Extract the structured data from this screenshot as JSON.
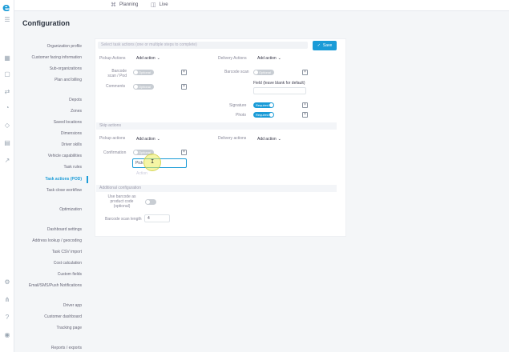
{
  "app": {
    "logo": "e",
    "title": "Configuration"
  },
  "topbar": {
    "planning_label": "Planning",
    "planning_icon": "planning-icon",
    "live_label": "Live",
    "live_icon": "live-icon"
  },
  "rail_icons": [
    "menu-icon",
    "grid-icon",
    "box-icon",
    "route-icon",
    "users-icon",
    "tag-icon",
    "report-icon",
    "chart-icon",
    "settings-icon",
    "network-icon",
    "help-icon",
    "account-icon"
  ],
  "sidebar": {
    "items": [
      "Organization profile",
      "Customer facing information",
      "Sub-organizations",
      "Plan and billing",
      "Depots",
      "Zones",
      "Saved locations",
      "Dimensions",
      "Driver skills",
      "Vehicle capabilities",
      "Task rules",
      "Task actions (POD)",
      "Task close workflow",
      "Optimization",
      "Dashboard settings",
      "Address lookup / geocoding",
      "Task CSV import",
      "Cost calculation",
      "Custom fields",
      "Email/SMS/Push Notifications",
      "Driver app",
      "Customer dashboard",
      "Tracking page",
      "Reports / exports"
    ],
    "active": "Task actions (POD)"
  },
  "form": {
    "search_placeholder": "Select task actions (one or multiple steps to complete)",
    "save_label": "Save",
    "save_icon": "check-icon",
    "pickup_actions_label": "Pickup Actions",
    "delivery_actions_label": "Delivery Actions",
    "add_action_label": "Add action",
    "remove_icon": "close-icon",
    "pickup_rows": [
      {
        "label": "Barcode scan / Pod",
        "toggle": "Optional"
      },
      {
        "label": "Comments",
        "toggle": "Optional"
      }
    ],
    "delivery_barcode_label": "Barcode scan",
    "delivery_barcode_toggle": "Optional",
    "delivery_field_label": "Field (leave blank for default)",
    "delivery_signature_label": "Signature",
    "delivery_signature_toggle": "Required",
    "delivery_photo_label": "Photo",
    "delivery_photo_toggle": "Required",
    "skip_section": "Skip actions",
    "skip_pickup_label": "Pickup actions",
    "skip_delivery_label": "Delivery actions",
    "confirmation_label": "Confirmation",
    "confirmation_toggle": "Optional",
    "confirmation_value": "Pick",
    "confirmation_hint": "Action",
    "additional_section": "Additional configuration",
    "use_barcode_label": "Use barcode as product code (optional)",
    "barcode_length_label": "Barcode scan length",
    "barcode_length_value": "4"
  },
  "colors": {
    "accent": "#1a9bd7",
    "highlight": "#ecec5a"
  }
}
